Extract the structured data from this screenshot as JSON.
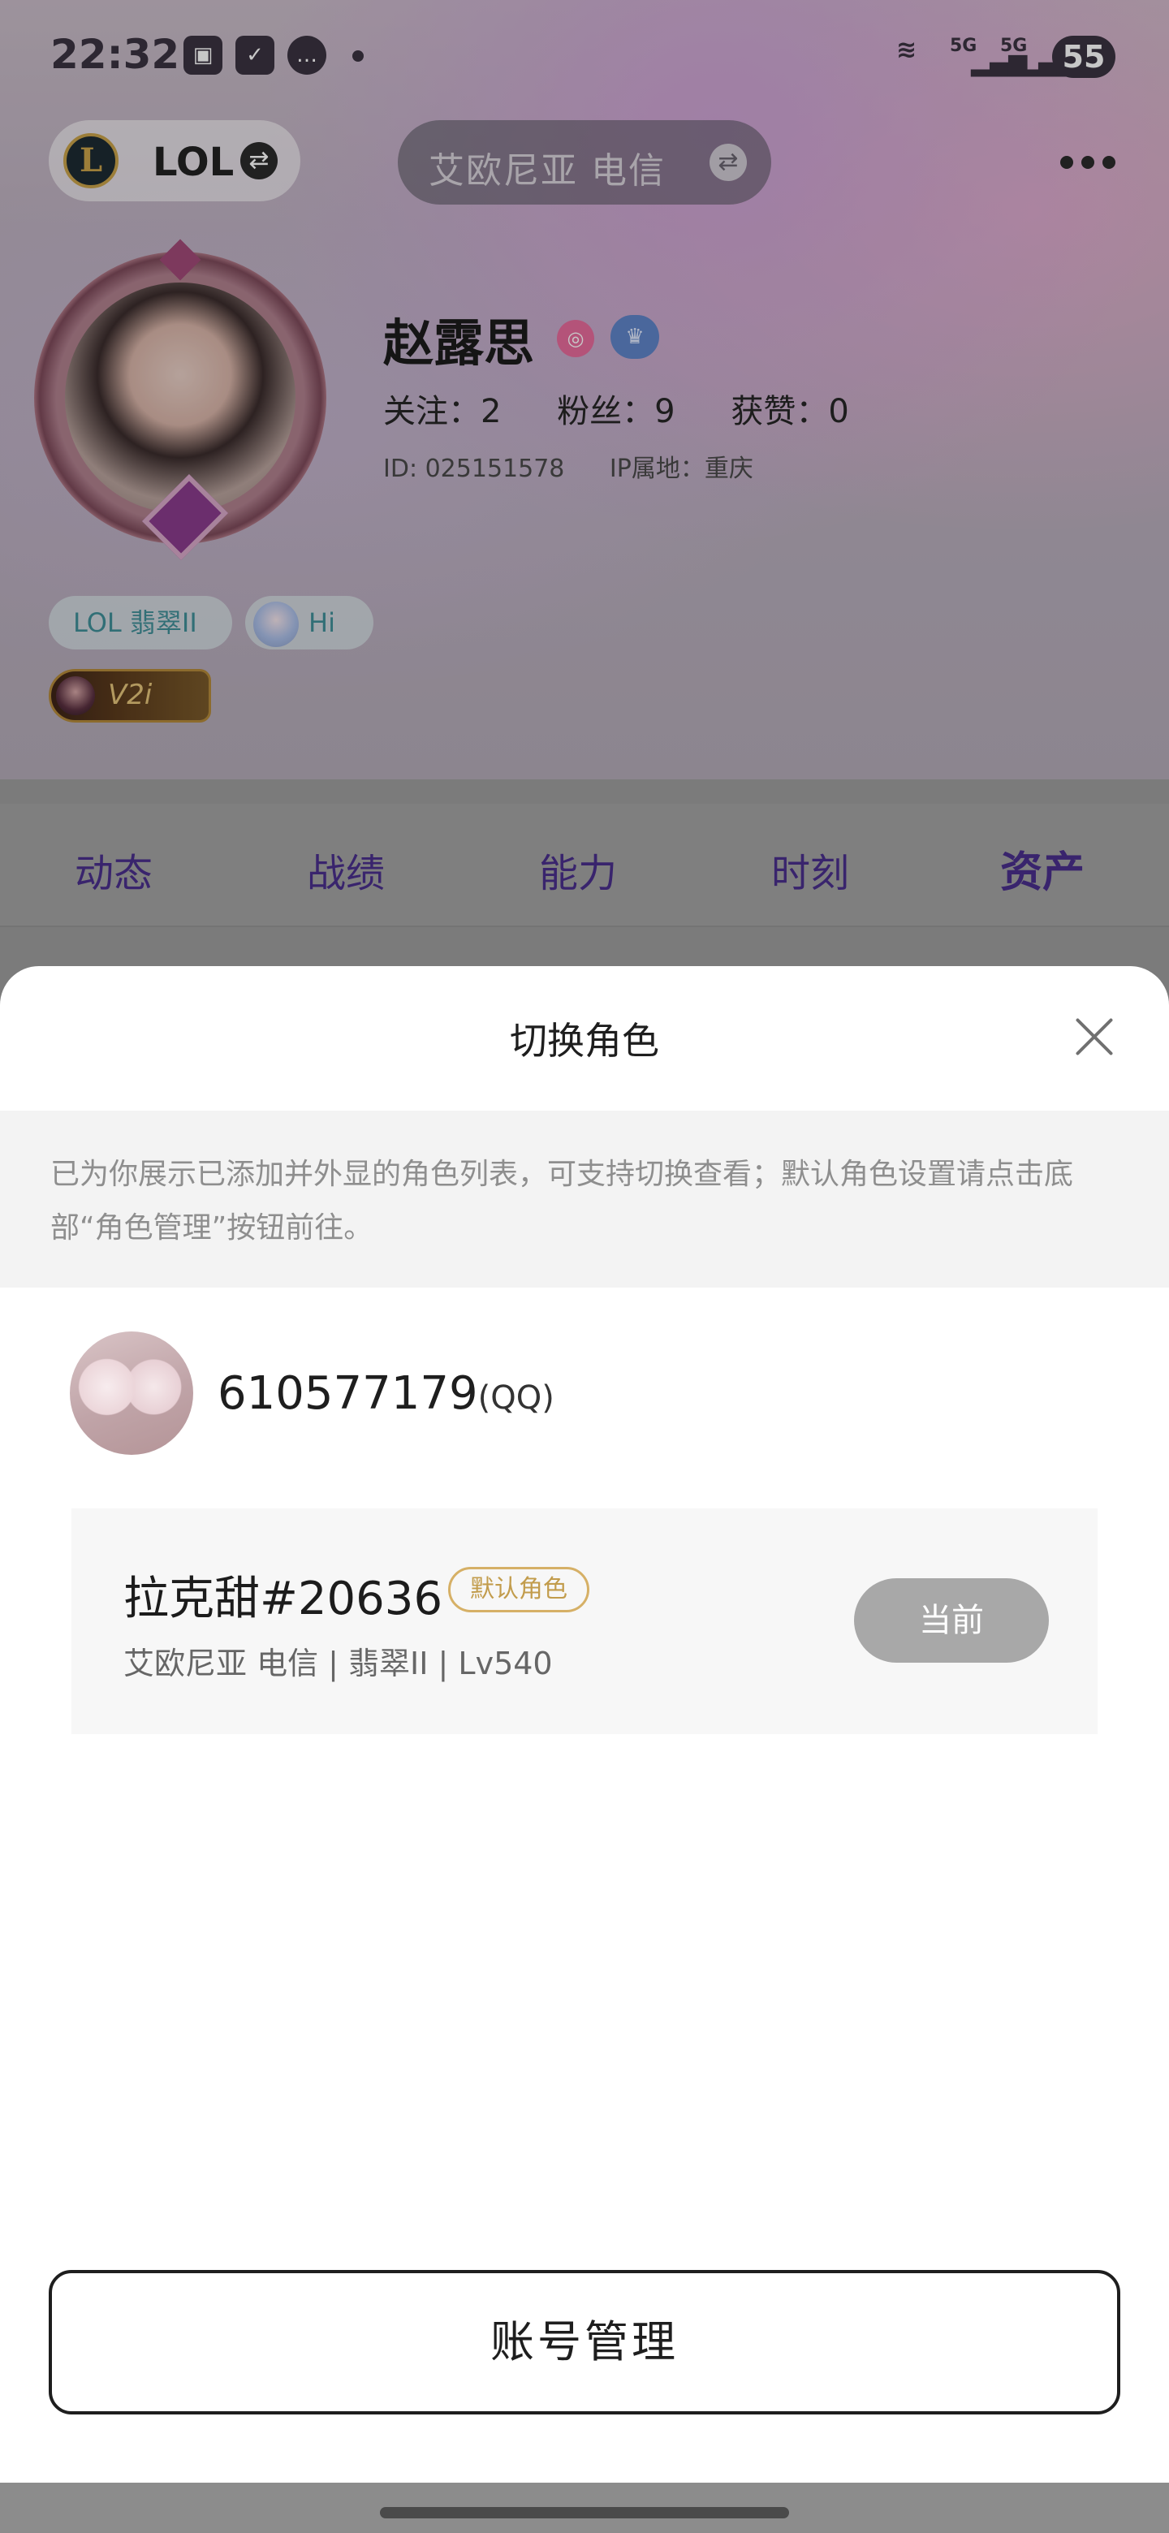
{
  "status_bar": {
    "time": "22:32",
    "network_1": "5G",
    "network_2": "5G",
    "battery": "55"
  },
  "top_bar": {
    "game_name": "LOL",
    "server": "艾欧尼亚  电信",
    "logo_letter": "L"
  },
  "profile": {
    "name": "赵露思",
    "stats": [
      "关注：2",
      "粉丝：9",
      "获赞：0"
    ],
    "id_label": "ID:  025151578",
    "ip_label": "IP属地：重庆",
    "tags": [
      "LOL 翡翠II",
      "Hi"
    ],
    "title_badge": "V2i"
  },
  "tabs": [
    {
      "label": "动态",
      "active": false
    },
    {
      "label": "战绩",
      "active": false
    },
    {
      "label": "能力",
      "active": false
    },
    {
      "label": "时刻",
      "active": false
    },
    {
      "label": "资产",
      "active": true
    }
  ],
  "sheet": {
    "title": "切换角色",
    "notice": "已为你展示已添加并外显的角色列表，可支持切换查看；默认角色设置请点击底部“角色管理”按钮前往。",
    "account": {
      "number": "610577179",
      "type": "(QQ)"
    },
    "role": {
      "name": "拉克甜#20636",
      "default_badge": "默认角色",
      "detail": "艾欧尼亚  电信 | 翡翠II | Lv540",
      "current_button": "当前"
    },
    "manage_button": "账号管理"
  },
  "colors": {
    "tab_text": "#4a2f8c",
    "default_badge": "#c29c4c",
    "current_button_bg": "#a8a8a8"
  }
}
